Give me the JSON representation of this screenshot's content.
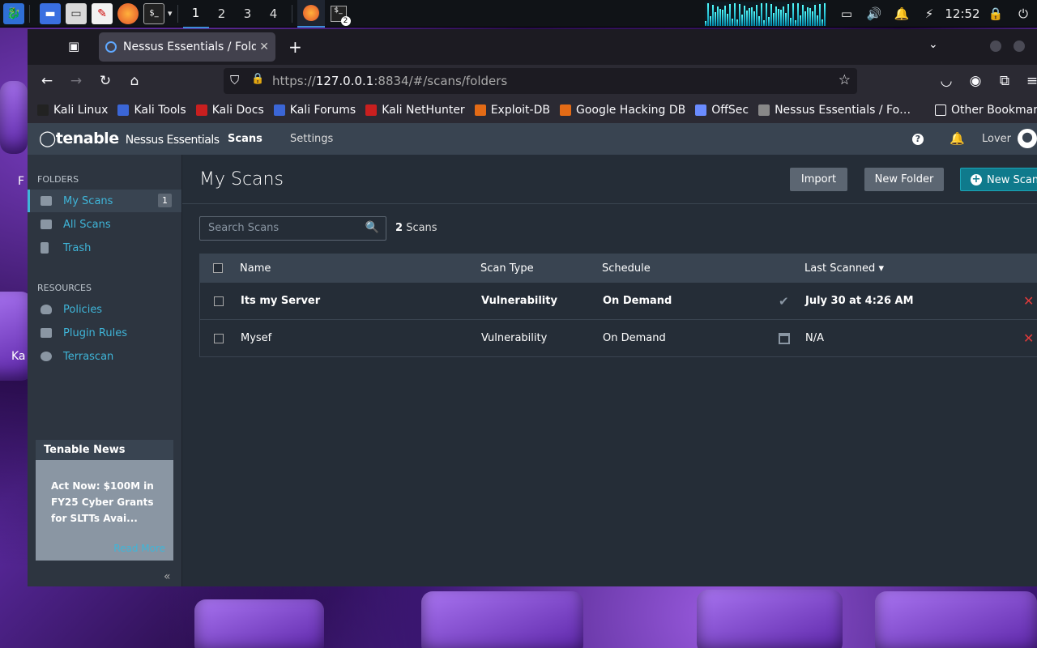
{
  "taskbar": {
    "workspaces": [
      "1",
      "2",
      "3",
      "4"
    ],
    "clock": "12:52",
    "terminal_badge": "2"
  },
  "desktop": {
    "edge_label_1": "F",
    "edge_label_2": "Ka"
  },
  "browser": {
    "tab_title": "Nessus Essentials / Folders",
    "url_prefix": "https://",
    "url_host": "127.0.0.1",
    "url_rest": ":8834/#/scans/folders",
    "bookmarks": [
      {
        "label": "Kali Linux",
        "color": "#222"
      },
      {
        "label": "Kali Tools",
        "color": "#3b66d6"
      },
      {
        "label": "Kali Docs",
        "color": "#c91f1f"
      },
      {
        "label": "Kali Forums",
        "color": "#3b66d6"
      },
      {
        "label": "Kali NetHunter",
        "color": "#c91f1f"
      },
      {
        "label": "Exploit-DB",
        "color": "#e36b16"
      },
      {
        "label": "Google Hacking DB",
        "color": "#e36b16"
      },
      {
        "label": "OffSec",
        "color": "#6a8cff"
      },
      {
        "label": "Nessus Essentials / Fo…",
        "color": "#888"
      }
    ],
    "other_bookmarks": "Other Bookmarks"
  },
  "app": {
    "logo": "tenable",
    "product": "Nessus Essentials",
    "nav": {
      "scans": "Scans",
      "settings": "Settings"
    },
    "user": "Lover",
    "sidebar": {
      "folders_heading": "FOLDERS",
      "folders": [
        {
          "label": "My Scans",
          "count": "1"
        },
        {
          "label": "All Scans"
        },
        {
          "label": "Trash"
        }
      ],
      "resources_heading": "RESOURCES",
      "resources": [
        {
          "label": "Policies"
        },
        {
          "label": "Plugin Rules"
        },
        {
          "label": "Terrascan"
        }
      ],
      "news": {
        "heading": "Tenable News",
        "body": "Act Now: $100M in FY25 Cyber Grants for SLTTs Avai...",
        "link": "Read More"
      }
    },
    "main": {
      "title": "My Scans",
      "buttons": {
        "import": "Import",
        "new_folder": "New Folder",
        "new_scan": "New Scan"
      },
      "search_placeholder": "Search Scans",
      "scan_count": "2",
      "scan_count_label": "Scans",
      "columns": {
        "name": "Name",
        "scan_type": "Scan Type",
        "schedule": "Schedule",
        "last_scanned": "Last Scanned ▾"
      },
      "rows": [
        {
          "name": "Its my Server",
          "scan_type": "Vulnerability",
          "schedule": "On Demand",
          "status_icon": "check-icon",
          "last_scanned": "July 30 at 4:26 AM",
          "bold": true
        },
        {
          "name": "Mysef",
          "scan_type": "Vulnerability",
          "schedule": "On Demand",
          "status_icon": "calendar-icon",
          "last_scanned": "N/A",
          "bold": false
        }
      ]
    }
  }
}
